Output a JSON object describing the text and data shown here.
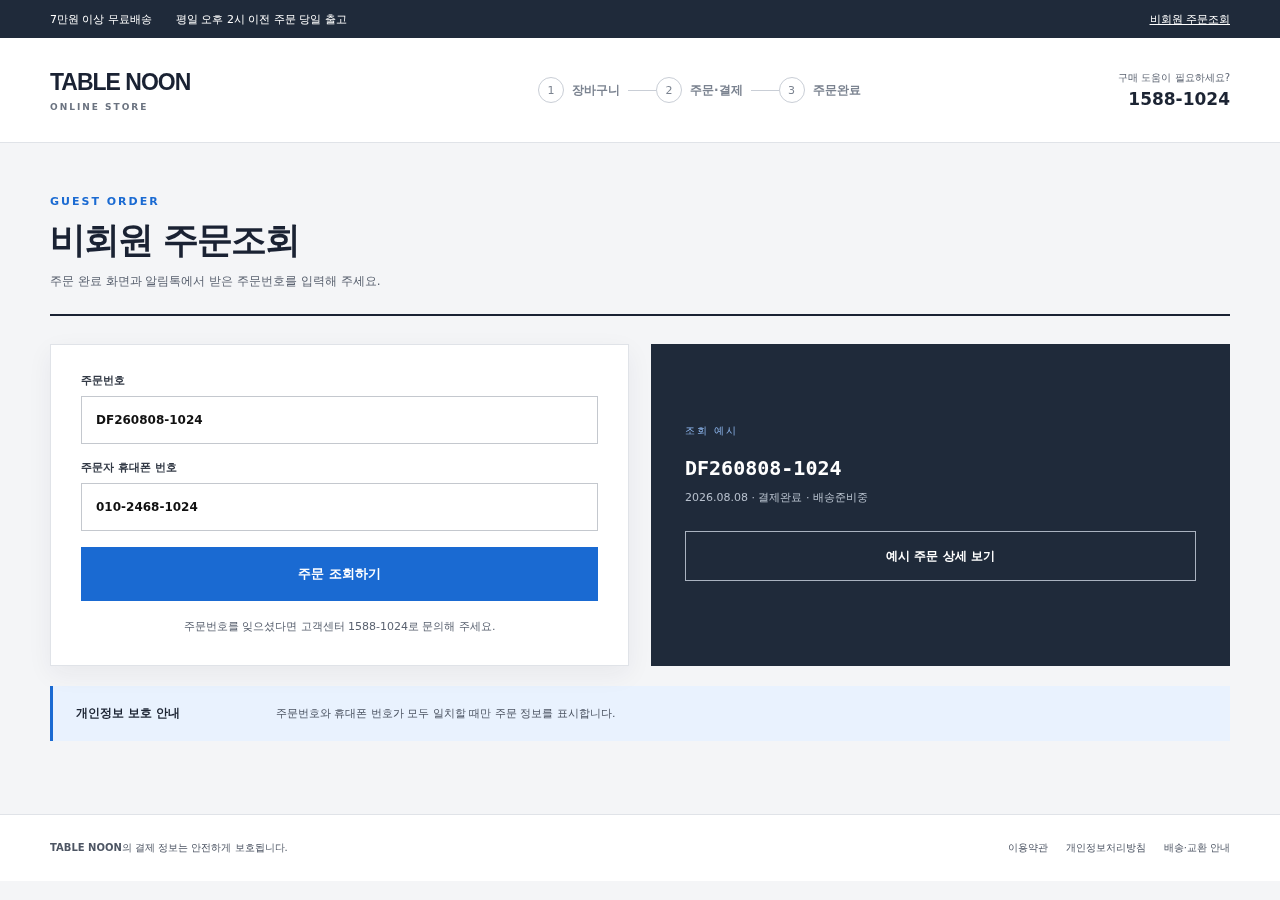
{
  "top_bar": {
    "notices": [
      "7만원 이상 무료배송",
      "평일 오후 2시 이전 주문 당일 출고"
    ],
    "link": "비회원 주문조회"
  },
  "header": {
    "logo": "TABLE NOON",
    "logo_sub": "ONLINE STORE",
    "steps": [
      {
        "number": "1",
        "label": "장바구니"
      },
      {
        "number": "2",
        "label": "주문·결제"
      },
      {
        "number": "3",
        "label": "주문완료"
      }
    ],
    "help_label": "구매 도움이 필요하세요?",
    "help_phone": "1588-1024"
  },
  "page": {
    "eyebrow": "GUEST ORDER",
    "title": "비회원 주문조회",
    "subtitle": "주문 완료 화면과 알림톡에서 받은 주문번호를 입력해 주세요."
  },
  "form": {
    "fields": [
      {
        "label": "주문번호",
        "value": "DF260808-1024"
      },
      {
        "label": "주문자 휴대폰 번호",
        "value": "010-2468-1024"
      }
    ],
    "submit": "주문 조회하기",
    "help": "주문번호를 잊으셨다면 고객센터 1588-1024로 문의해 주세요."
  },
  "example": {
    "label": "조회 예시",
    "order_number": "DF260808-1024",
    "meta": "2026.08.08 · 결제완료 · 배송준비중",
    "button": "예시 주문 상세 보기"
  },
  "notice": {
    "title": "개인정보 보호 안내",
    "text": "주문번호와 휴대폰 번호가 모두 일치할 때만 주문 정보를 표시합니다."
  },
  "footer": {
    "text": "**TABLE NOON**의 결제 정보는 안전하게 보호됩니다.",
    "links": [
      "이용약관",
      "개인정보처리방침",
      "배송·교환 안내"
    ]
  }
}
